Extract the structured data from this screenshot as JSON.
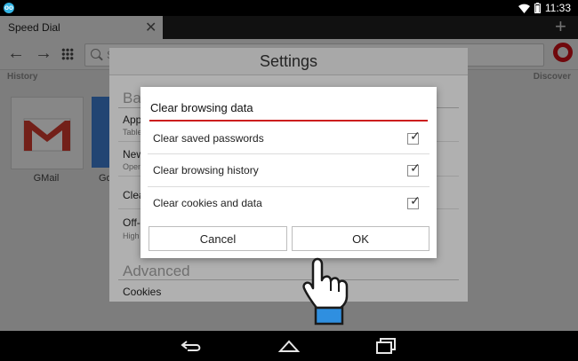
{
  "status_bar": {
    "time": "11:33"
  },
  "browser": {
    "tab_title": "Speed Dial",
    "url_placeholder": "Search or enter address",
    "url_visible_text": "S"
  },
  "speed_dial": {
    "left_label": "History",
    "right_label": "Discover",
    "tiles": [
      {
        "label": "GMail"
      },
      {
        "label": "Go"
      }
    ]
  },
  "settings": {
    "title": "Settings",
    "basic_header": "Ba",
    "basic_rows": [
      {
        "title": "App",
        "subtitle": "Table"
      },
      {
        "title": "New",
        "subtitle": "Open"
      },
      {
        "title": "Clea",
        "subtitle": ""
      },
      {
        "title": "Off-",
        "subtitle": "High"
      }
    ],
    "advanced_header": "Advanced",
    "advanced_rows": [
      {
        "title": "Cookies"
      }
    ]
  },
  "dialog": {
    "title": "Clear browsing data",
    "options": [
      {
        "label": "Clear saved passwords",
        "checked": true
      },
      {
        "label": "Clear browsing history",
        "checked": true
      },
      {
        "label": "Clear cookies and data",
        "checked": true
      }
    ],
    "cancel_label": "Cancel",
    "ok_label": "OK",
    "accent_color": "#cc1d1d"
  }
}
